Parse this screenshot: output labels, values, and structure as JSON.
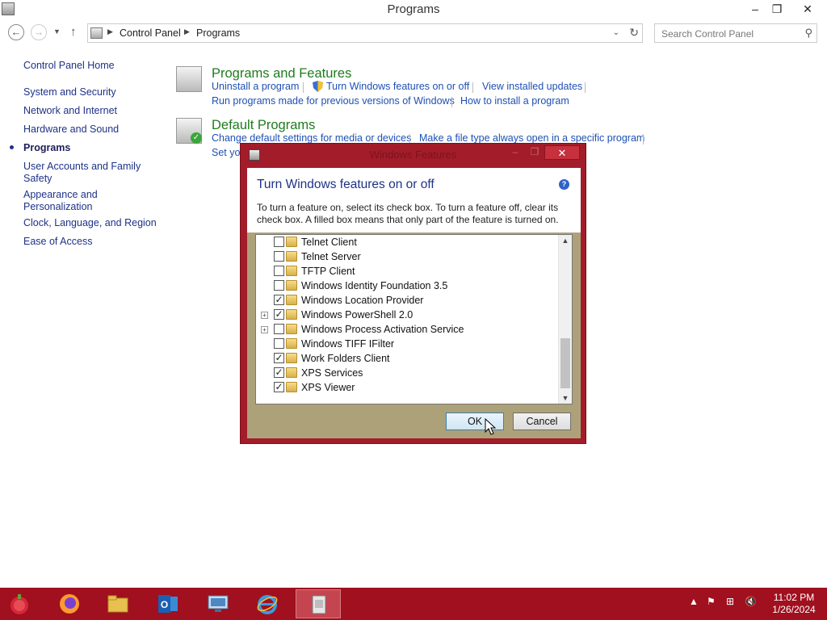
{
  "window": {
    "title": "Programs",
    "minimize": "–",
    "maximize": "❐",
    "close": "✕"
  },
  "address": {
    "crumbs": [
      "Control Panel",
      "Programs"
    ],
    "search_placeholder": "Search Control Panel"
  },
  "leftnav": {
    "items": [
      "Control Panel Home",
      "System and Security",
      "Network and Internet",
      "Hardware and Sound",
      "Programs",
      "User Accounts and Family Safety",
      "Appearance and Personalization",
      "Clock, Language, and Region",
      "Ease of Access"
    ],
    "current": "Programs"
  },
  "sections": {
    "programs_features": {
      "heading": "Programs and Features",
      "links": [
        "Uninstall a program",
        "Turn Windows features on or off",
        "View installed updates",
        "Run programs made for previous versions of Windows",
        "How to install a program"
      ]
    },
    "default_programs": {
      "heading": "Default Programs",
      "links": [
        "Change default settings for media or devices",
        "Make a file type always open in a specific program",
        "Set you"
      ]
    }
  },
  "dialog": {
    "title": "Windows Features",
    "heading": "Turn Windows features on or off",
    "description": "To turn a feature on, select its check box. To turn a feature off, clear its check box. A filled box means that only part of the feature is turned on.",
    "features": [
      {
        "label": "Telnet Client",
        "checked": false,
        "expandable": false
      },
      {
        "label": "Telnet Server",
        "checked": false,
        "expandable": false
      },
      {
        "label": "TFTP Client",
        "checked": false,
        "expandable": false
      },
      {
        "label": "Windows Identity Foundation 3.5",
        "checked": false,
        "expandable": false
      },
      {
        "label": "Windows Location Provider",
        "checked": true,
        "expandable": false
      },
      {
        "label": "Windows PowerShell 2.0",
        "checked": true,
        "expandable": true
      },
      {
        "label": "Windows Process Activation Service",
        "checked": false,
        "expandable": true
      },
      {
        "label": "Windows TIFF IFilter",
        "checked": false,
        "expandable": false
      },
      {
        "label": "Work Folders Client",
        "checked": true,
        "expandable": false
      },
      {
        "label": "XPS Services",
        "checked": true,
        "expandable": false
      },
      {
        "label": "XPS Viewer",
        "checked": true,
        "expandable": false
      }
    ],
    "ok_label": "OK",
    "cancel_label": "Cancel"
  },
  "taskbar": {
    "apps": [
      "start-orb",
      "firefox",
      "file-explorer",
      "outlook",
      "remote-desktop",
      "internet-explorer",
      "control-panel"
    ],
    "active_app": "control-panel",
    "time": "11:02 PM",
    "date": "1/26/2024"
  },
  "colors": {
    "accent": "#a31c2a",
    "link": "#1e50b4",
    "heading_green": "#1f7c1f",
    "taskbar": "#a0101e"
  }
}
